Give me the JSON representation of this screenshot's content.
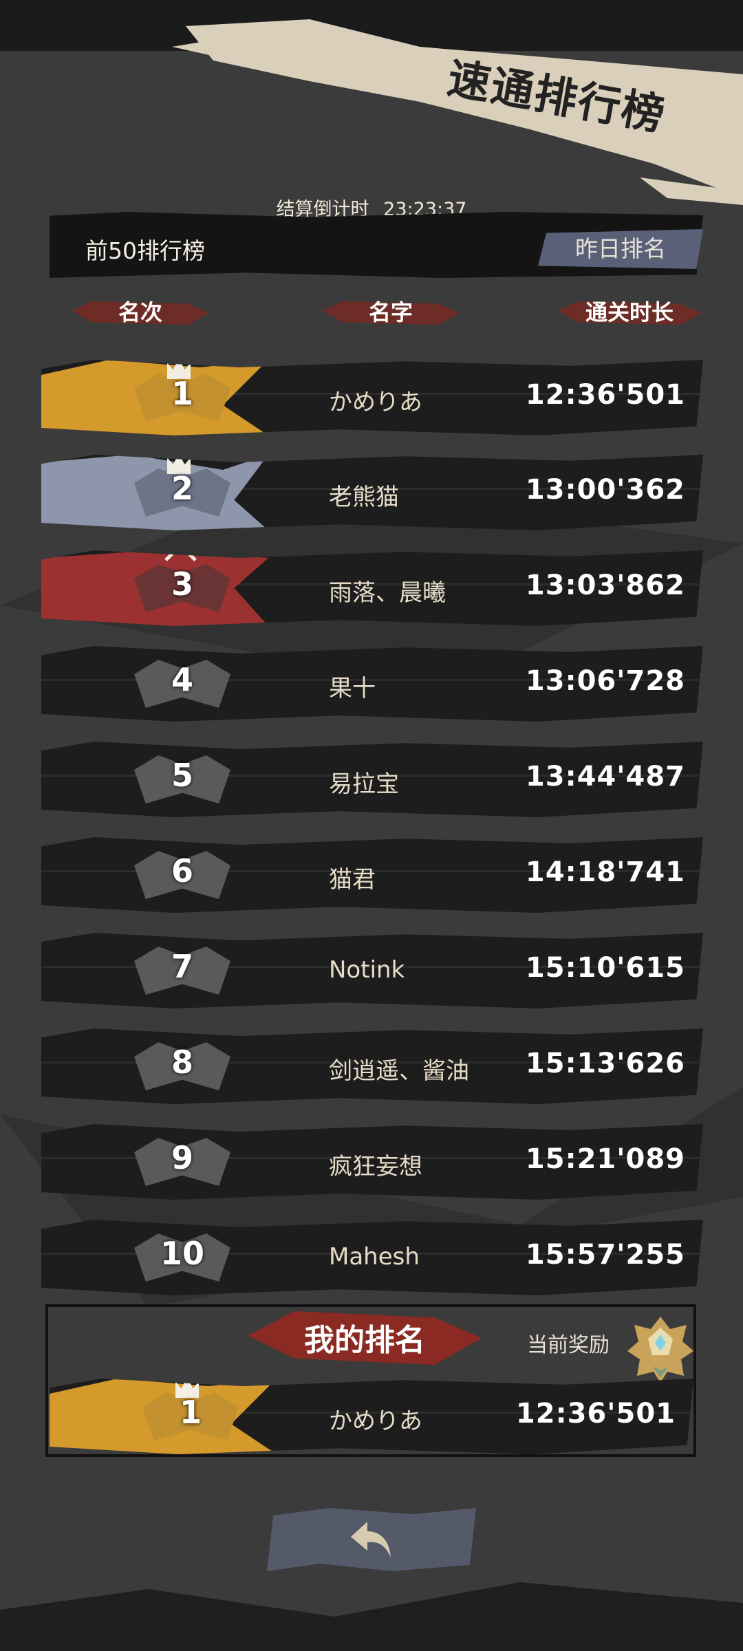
{
  "title": "速通排行榜",
  "countdown": {
    "label": "结算倒计时",
    "time": "23:23:37"
  },
  "header": {
    "label": "前50排行榜",
    "yesterday_button": "昨日排名"
  },
  "columns": {
    "rank": "名次",
    "name": "名字",
    "time": "通关时长"
  },
  "rows": [
    {
      "rank": "1",
      "name": "かめりあ",
      "time": "12:36'501"
    },
    {
      "rank": "2",
      "name": "老熊猫",
      "time": "13:00'362"
    },
    {
      "rank": "3",
      "name": "雨落、晨曦",
      "time": "13:03'862"
    },
    {
      "rank": "4",
      "name": "果十",
      "time": "13:06'728"
    },
    {
      "rank": "5",
      "name": "易拉宝",
      "time": "13:44'487"
    },
    {
      "rank": "6",
      "name": "猫君",
      "time": "14:18'741"
    },
    {
      "rank": "7",
      "name": "Notink",
      "time": "15:10'615"
    },
    {
      "rank": "8",
      "name": "剑逍遥、酱油",
      "time": "15:13'626"
    },
    {
      "rank": "9",
      "name": "疯狂妄想",
      "time": "15:21'089"
    },
    {
      "rank": "10",
      "name": "Mahesh",
      "time": "15:57'255"
    }
  ],
  "my_rank": {
    "title": "我的排名",
    "reward_label": "当前奖励",
    "rank": "1",
    "name": "かめりあ",
    "time": "12:36'501"
  },
  "icons": {
    "back": "back-arrow-icon",
    "reward": "reward-medal-icon",
    "crown": "crown-icon",
    "chevron": "chevron-up-icon"
  },
  "colors": {
    "gold": "#d59a2c",
    "silver": "#8d96ab",
    "bronze": "#9b3231",
    "accent": "#7a2b22"
  }
}
